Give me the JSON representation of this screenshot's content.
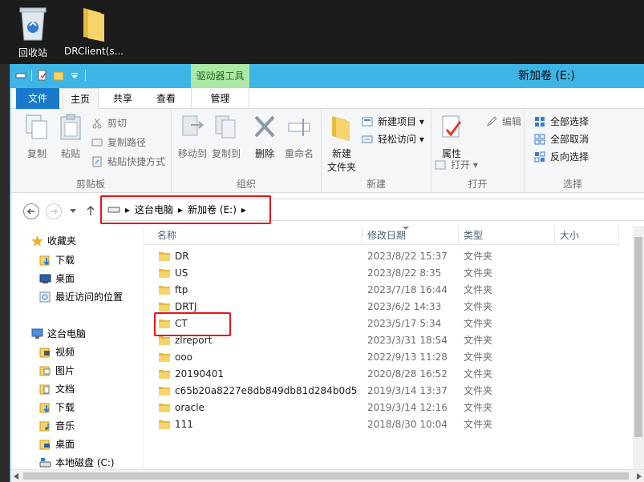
{
  "desktop": {
    "icons": [
      {
        "label": "回收站",
        "icon": "recycle-bin-icon"
      },
      {
        "label": "DRClient(s...",
        "icon": "folder-icon"
      }
    ]
  },
  "window": {
    "title": "新加卷 (E:)",
    "contextual_tab_header": "驱动器工具"
  },
  "tabs": {
    "file": "文件",
    "home": "主页",
    "share": "共享",
    "view": "查看",
    "manage": "管理"
  },
  "ribbon": {
    "clipboard": {
      "label": "剪贴板",
      "copy": "复制",
      "paste": "粘贴",
      "cut": "剪切",
      "copy_path": "复制路径",
      "paste_shortcut": "粘贴快捷方式"
    },
    "organize": {
      "label": "组织",
      "move_to": "移动到",
      "copy_to": "复制到",
      "delete": "删除",
      "rename": "重命名"
    },
    "new": {
      "label": "新建",
      "new_folder": "新建\n文件夹",
      "new_folder_l1": "新建",
      "new_folder_l2": "文件夹",
      "new_item": "新建项目",
      "easy_access": "轻松访问"
    },
    "open": {
      "label": "打开",
      "properties": "属性",
      "open": "打开",
      "edit": "编辑"
    },
    "select": {
      "label": "选择",
      "select_all": "全部选择",
      "select_none": "全部取消",
      "invert": "反向选择"
    }
  },
  "address": {
    "crumbs": [
      "这台电脑",
      "新加卷 (E:)"
    ]
  },
  "nav": {
    "favorites": "收藏夹",
    "fav_items": [
      "下载",
      "桌面",
      "最近访问的位置"
    ],
    "this_pc": "这台电脑",
    "pc_items": [
      "视频",
      "图片",
      "文档",
      "下载",
      "音乐",
      "桌面",
      "本地磁盘 (C:)"
    ]
  },
  "columns": {
    "name": "名称",
    "date": "修改日期",
    "type": "类型",
    "size": "大小"
  },
  "files": [
    {
      "name": "DR",
      "date": "2023/8/22 15:37",
      "type": "文件夹"
    },
    {
      "name": "US",
      "date": "2023/8/22 8:35",
      "type": "文件夹"
    },
    {
      "name": "ftp",
      "date": "2023/7/18 16:44",
      "type": "文件夹"
    },
    {
      "name": "DRTJ",
      "date": "2023/6/2 14:33",
      "type": "文件夹"
    },
    {
      "name": "CT",
      "date": "2023/5/17 5:34",
      "type": "文件夹"
    },
    {
      "name": "zlreport",
      "date": "2023/3/31 18:54",
      "type": "文件夹"
    },
    {
      "name": "ooo",
      "date": "2022/9/13 11:28",
      "type": "文件夹"
    },
    {
      "name": "20190401",
      "date": "2020/8/28 16:52",
      "type": "文件夹"
    },
    {
      "name": "c65b20a8227e8db849db81d284b0d5",
      "date": "2019/3/14 13:37",
      "type": "文件夹"
    },
    {
      "name": "oracle",
      "date": "2019/3/14 12:16",
      "type": "文件夹"
    },
    {
      "name": "111",
      "date": "2018/8/30 10:04",
      "type": "文件夹"
    }
  ],
  "colors": {
    "accent": "#1979ca",
    "titlebar": "#3fb5e6",
    "drive_tools": "#ace7a6",
    "highlight_box": "#e0161d",
    "folder": "#f5c542"
  }
}
